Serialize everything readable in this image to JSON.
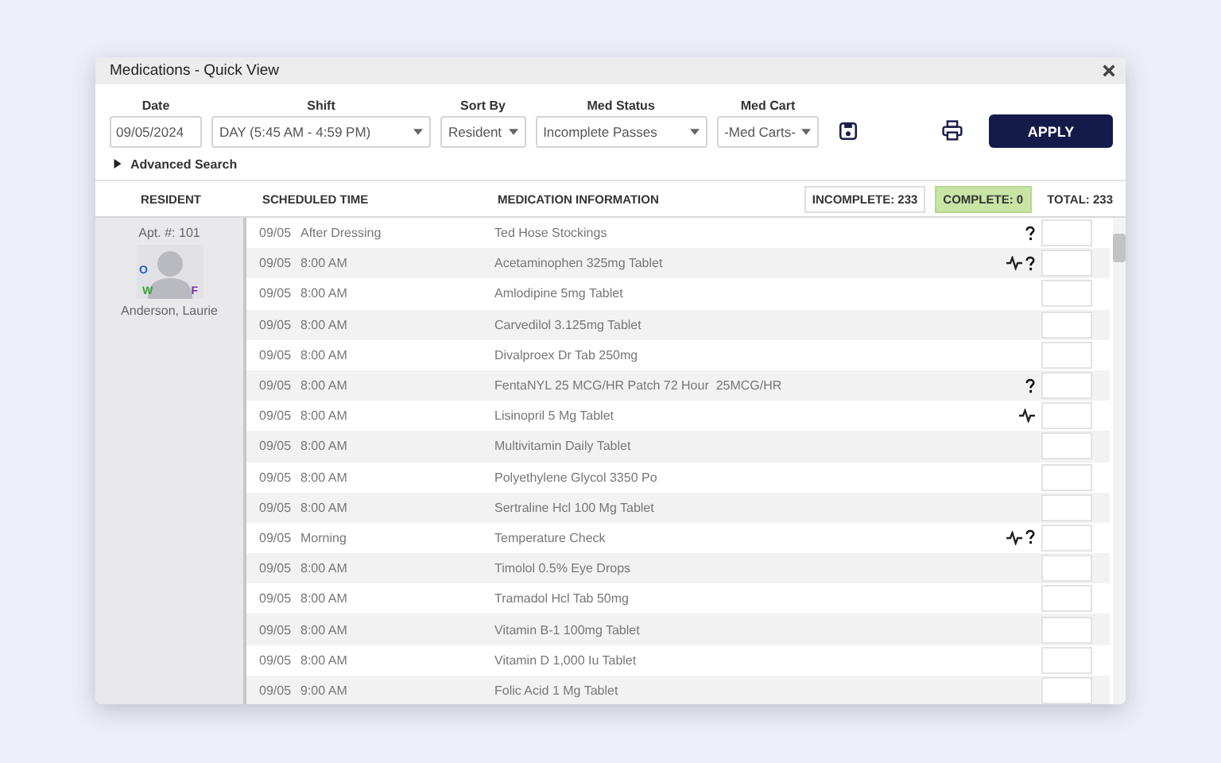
{
  "window": {
    "title": "Medications - Quick View"
  },
  "filters": [
    {
      "kind": "input",
      "label": "Date",
      "value": "09/05/2024"
    },
    {
      "kind": "select",
      "label": "Shift",
      "value": "DAY (5:45 AM - 4:59 PM)"
    },
    {
      "kind": "select",
      "label": "Sort By",
      "value": "Resident"
    },
    {
      "kind": "select",
      "label": "Med Status",
      "value": "Incomplete Passes"
    },
    {
      "kind": "select",
      "label": "Med Cart",
      "value": "-Med Carts-"
    }
  ],
  "apply_button": "APPLY",
  "advanced_search": {
    "label": "Advanced Search",
    "expanded": false
  },
  "columns": [
    "RESIDENT",
    "SCHEDULED TIME",
    "MEDICATION INFORMATION"
  ],
  "counts": [
    {
      "kind": "incomplete",
      "label": "INCOMPLETE: 233"
    },
    {
      "kind": "complete",
      "label": "COMPLETE: 0"
    },
    {
      "kind": "total",
      "label": "TOTAL: 233"
    }
  ],
  "resident": {
    "apartment": "Apt. #: 101",
    "name": "Anderson, Laurie",
    "badges": [
      "O",
      "W",
      "F"
    ]
  },
  "rows": [
    {
      "date": "09/05",
      "time": "After Dressing",
      "medication": "Ted Hose Stockings",
      "vitals": false,
      "question": true
    },
    {
      "date": "09/05",
      "time": "8:00 AM",
      "medication": "Acetaminophen 325mg Tablet",
      "vitals": true,
      "question": true
    },
    {
      "date": "09/05",
      "time": "8:00 AM",
      "medication": "Amlodipine 5mg Tablet",
      "vitals": false,
      "question": false
    },
    {
      "date": "09/05",
      "time": "8:00 AM",
      "medication": "Carvedilol 3.125mg Tablet",
      "vitals": false,
      "question": false
    },
    {
      "date": "09/05",
      "time": "8:00 AM",
      "medication": "Divalproex Dr Tab 250mg",
      "vitals": false,
      "question": false
    },
    {
      "date": "09/05",
      "time": "8:00 AM",
      "medication": "FentaNYL 25 MCG/HR Patch 72 Hour  25MCG/HR",
      "vitals": false,
      "question": true
    },
    {
      "date": "09/05",
      "time": "8:00 AM",
      "medication": "Lisinopril 5 Mg Tablet",
      "vitals": true,
      "question": false
    },
    {
      "date": "09/05",
      "time": "8:00 AM",
      "medication": "Multivitamin Daily Tablet",
      "vitals": false,
      "question": false
    },
    {
      "date": "09/05",
      "time": "8:00 AM",
      "medication": "Polyethylene Glycol 3350 Po",
      "vitals": false,
      "question": false
    },
    {
      "date": "09/05",
      "time": "8:00 AM",
      "medication": "Sertraline Hcl 100 Mg Tablet",
      "vitals": false,
      "question": false
    },
    {
      "date": "09/05",
      "time": "Morning",
      "medication": "Temperature Check",
      "vitals": true,
      "question": true
    },
    {
      "date": "09/05",
      "time": "8:00 AM",
      "medication": "Timolol 0.5% Eye Drops",
      "vitals": false,
      "question": false
    },
    {
      "date": "09/05",
      "time": "8:00 AM",
      "medication": "Tramadol Hcl Tab 50mg",
      "vitals": false,
      "question": false
    },
    {
      "date": "09/05",
      "time": "8:00 AM",
      "medication": "Vitamin B-1 100mg Tablet",
      "vitals": false,
      "question": false
    },
    {
      "date": "09/05",
      "time": "8:00 AM",
      "medication": "Vitamin D 1,000 Iu Tablet",
      "vitals": false,
      "question": false
    },
    {
      "date": "09/05",
      "time": "9:00 AM",
      "medication": "Folic Acid 1 Mg Tablet",
      "vitals": false,
      "question": false
    }
  ]
}
